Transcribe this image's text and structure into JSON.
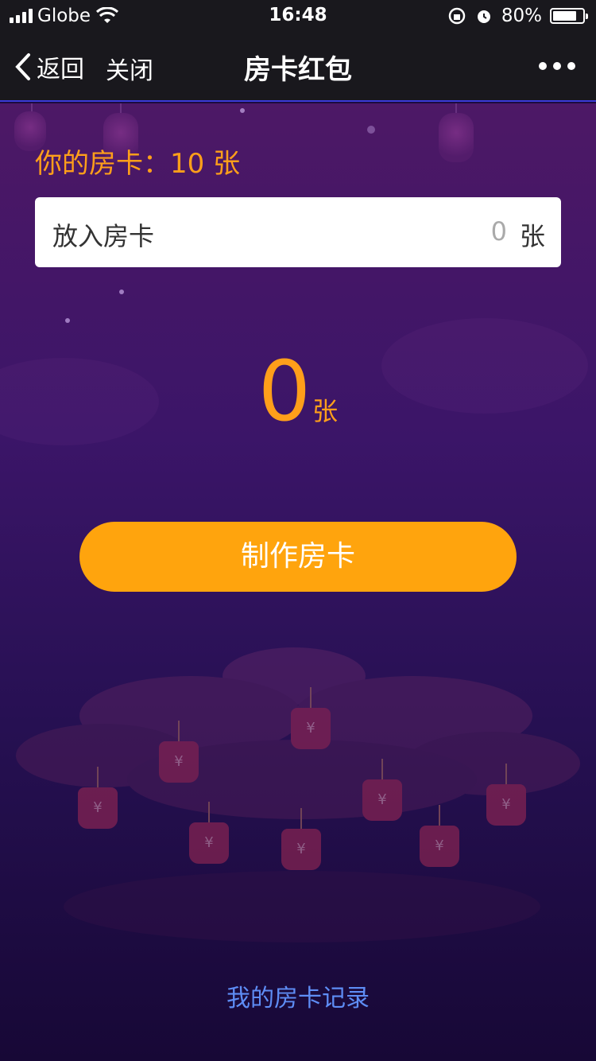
{
  "status_bar": {
    "carrier": "Globe",
    "time": "16:48",
    "battery_percent": "80%",
    "battery_level": 0.8,
    "icons": [
      "signal-icon",
      "wifi-icon",
      "orientation-lock-icon",
      "alarm-icon",
      "battery-icon"
    ]
  },
  "nav": {
    "back_label": "返回",
    "close_label": "关闭",
    "title": "房卡红包",
    "more_icon": "more-dots-icon"
  },
  "main": {
    "cards_label": "你的房卡：",
    "cards_value": "10 张",
    "input": {
      "label": "放入房卡",
      "value": "0",
      "unit": "张"
    },
    "big_count": {
      "value": "0",
      "unit": "张"
    },
    "make_button_label": "制作房卡",
    "records_link": "我的房卡记录"
  },
  "colors": {
    "accent_orange": "#ffa40d",
    "count_orange": "#ff9f1a",
    "link_blue": "#5e8df5",
    "nav_bg": "#19181d",
    "bg_top": "#4d1866",
    "bg_bottom": "#170836"
  }
}
